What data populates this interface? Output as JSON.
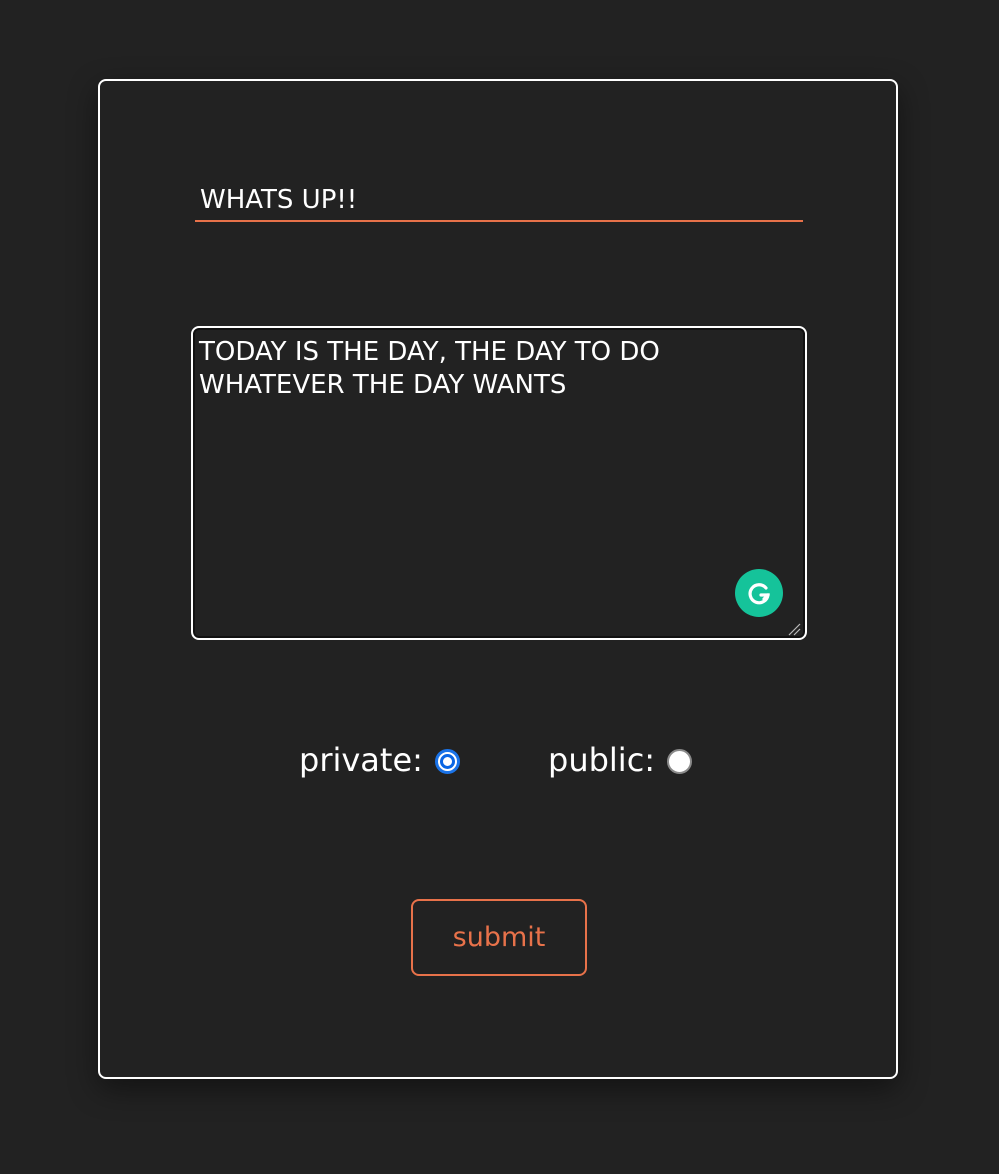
{
  "form": {
    "title_value": "WHATS UP!!",
    "body_value": "TODAY IS THE DAY, THE DAY TO DO WHATEVER THE DAY WANTS",
    "visibility": {
      "private_label": "private:",
      "public_label": "public:",
      "selected": "private"
    },
    "submit_label": "submit"
  },
  "icons": {
    "grammar": "grammarly-icon",
    "resize": "resize-grip-icon"
  },
  "colors": {
    "background": "#222222",
    "accent": "#e8724a",
    "border": "#ffffff",
    "radio_selected": "#1a73e8",
    "grammar_badge": "#15c39a"
  }
}
